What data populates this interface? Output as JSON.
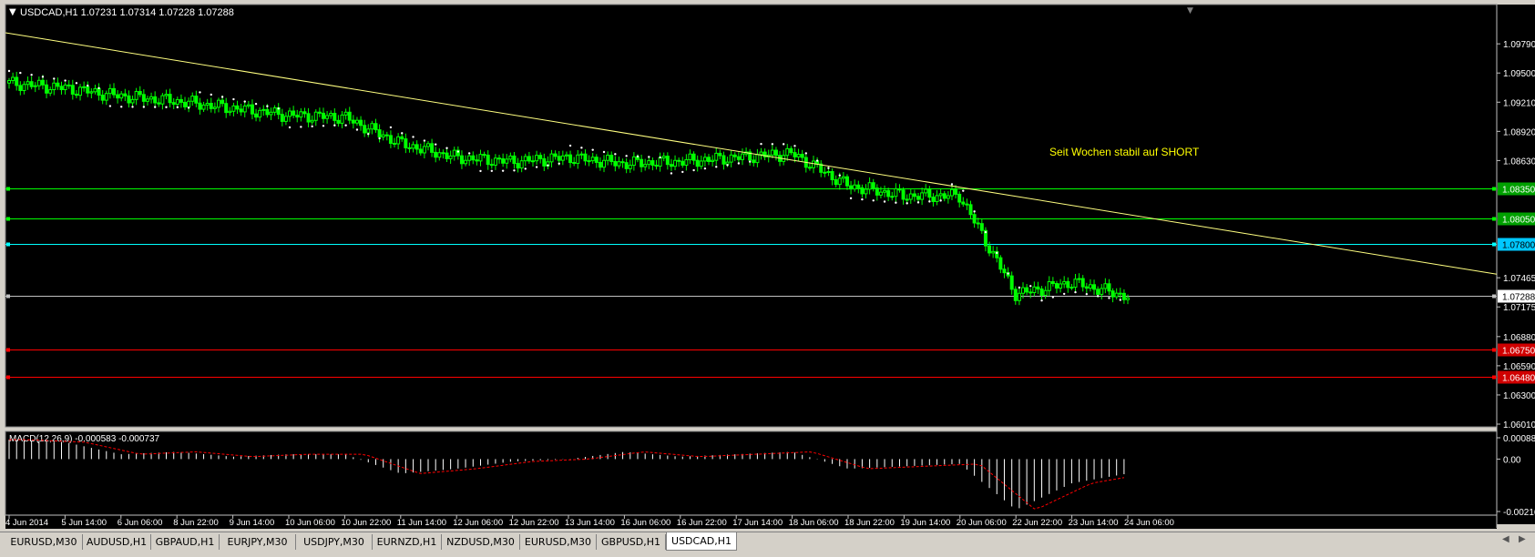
{
  "header": {
    "title": "USDCAD,H1",
    "ohlc": "1.07231 1.07314 1.07228 1.07288"
  },
  "annotation": "Seit Wochen stabil auf SHORT",
  "price_axis": {
    "ticks": [
      "1.09790",
      "1.09500",
      "1.09210",
      "1.08920",
      "1.08630",
      "1.08350",
      "1.08050",
      "1.07800",
      "1.07465",
      "1.07288",
      "1.07175",
      "1.06880",
      "1.06750",
      "1.06590",
      "1.06480",
      "1.06300",
      "1.06010"
    ]
  },
  "levels": [
    {
      "label": "1.08350",
      "price": 1.0835,
      "color": "#00ff00",
      "badge_bg": "#00a000",
      "badge_text": "#ffffff"
    },
    {
      "label": "1.08050",
      "price": 1.0805,
      "color": "#00ff00",
      "badge_bg": "#00a000",
      "badge_text": "#ffffff"
    },
    {
      "label": "1.07800",
      "price": 1.078,
      "color": "#00ffff",
      "badge_bg": "#00c8ff",
      "badge_text": "#000000"
    },
    {
      "label": "1.07288",
      "price": 1.07288,
      "color": "#c0c0c0",
      "badge_bg": "#ffffff",
      "badge_text": "#000000"
    },
    {
      "label": "1.06750",
      "price": 1.0675,
      "color": "#ff0000",
      "badge_bg": "#d00000",
      "badge_text": "#ffffff"
    },
    {
      "label": "1.06480",
      "price": 1.0648,
      "color": "#ff0000",
      "badge_bg": "#d00000",
      "badge_text": "#ffffff"
    }
  ],
  "macd": {
    "title": "MACD(12,26,9) -0.000583 -0.000737",
    "ticks": [
      "0.000882",
      "0.00",
      "-0.002169"
    ]
  },
  "time_axis": {
    "labels": [
      "4 Jun 2014",
      "5 Jun 14:00",
      "6 Jun 06:00",
      "8 Jun 22:00",
      "9 Jun 14:00",
      "10 Jun 06:00",
      "10 Jun 22:00",
      "11 Jun 14:00",
      "12 Jun 06:00",
      "12 Jun 22:00",
      "13 Jun 14:00",
      "16 Jun 06:00",
      "16 Jun 22:00",
      "17 Jun 14:00",
      "18 Jun 06:00",
      "18 Jun 22:00",
      "19 Jun 14:00",
      "20 Jun 06:00",
      "22 Jun 22:00",
      "23 Jun 14:00",
      "24 Jun 06:00"
    ]
  },
  "tabs": [
    {
      "label": "EURUSD,M30",
      "active": false
    },
    {
      "label": "AUDUSD,H1",
      "active": false
    },
    {
      "label": "GBPAUD,H1",
      "active": false
    },
    {
      "label": "EURJPY,M30",
      "active": false
    },
    {
      "label": "USDJPY,M30",
      "active": false
    },
    {
      "label": "EURNZD,H1",
      "active": false
    },
    {
      "label": "NZDUSD,M30",
      "active": false
    },
    {
      "label": "EURUSD,M30",
      "active": false
    },
    {
      "label": "GBPUSD,H1",
      "active": false
    },
    {
      "label": "USDCAD,H1",
      "active": true
    }
  ],
  "colors": {
    "background": "#000000",
    "candles": "#00ff00",
    "trendline": "#ffff80",
    "sar": "#ffffff",
    "annotation": "#ffff00",
    "macd_signal": "#ff0000"
  },
  "chart_data": {
    "type": "line",
    "symbol": "USDCAD,H1",
    "x": [
      "4 Jun 2014",
      "5 Jun 14:00",
      "6 Jun 06:00",
      "8 Jun 22:00",
      "9 Jun 14:00",
      "10 Jun 06:00",
      "10 Jun 22:00",
      "11 Jun 14:00",
      "12 Jun 06:00",
      "12 Jun 22:00",
      "13 Jun 14:00",
      "16 Jun 06:00",
      "16 Jun 22:00",
      "17 Jun 14:00",
      "18 Jun 06:00",
      "18 Jun 22:00",
      "19 Jun 14:00",
      "20 Jun 06:00",
      "22 Jun 22:00",
      "23 Jun 14:00",
      "24 Jun 06:00"
    ],
    "close": [
      1.094,
      1.0935,
      1.0927,
      1.0922,
      1.0915,
      1.0908,
      1.0906,
      1.088,
      1.0866,
      1.0862,
      1.0866,
      1.086,
      1.0862,
      1.0866,
      1.087,
      1.0838,
      1.0828,
      1.0828,
      1.073,
      1.0742,
      1.0728
    ],
    "ylim": [
      1.0601,
      1.099
    ],
    "trendline": [
      1.099,
      1.075
    ],
    "macd": [
      0.0008,
      0.0007,
      0.0002,
      0.0003,
      0.0001,
      0.0002,
      0.0002,
      -0.0006,
      -0.0004,
      -0.0001,
      0.0,
      0.0003,
      0.0001,
      0.0002,
      0.0003,
      -0.0004,
      -0.0003,
      -0.0002,
      -0.0021,
      -0.001,
      -0.0006
    ],
    "macd_ylim": [
      -0.002169,
      0.000882
    ]
  }
}
